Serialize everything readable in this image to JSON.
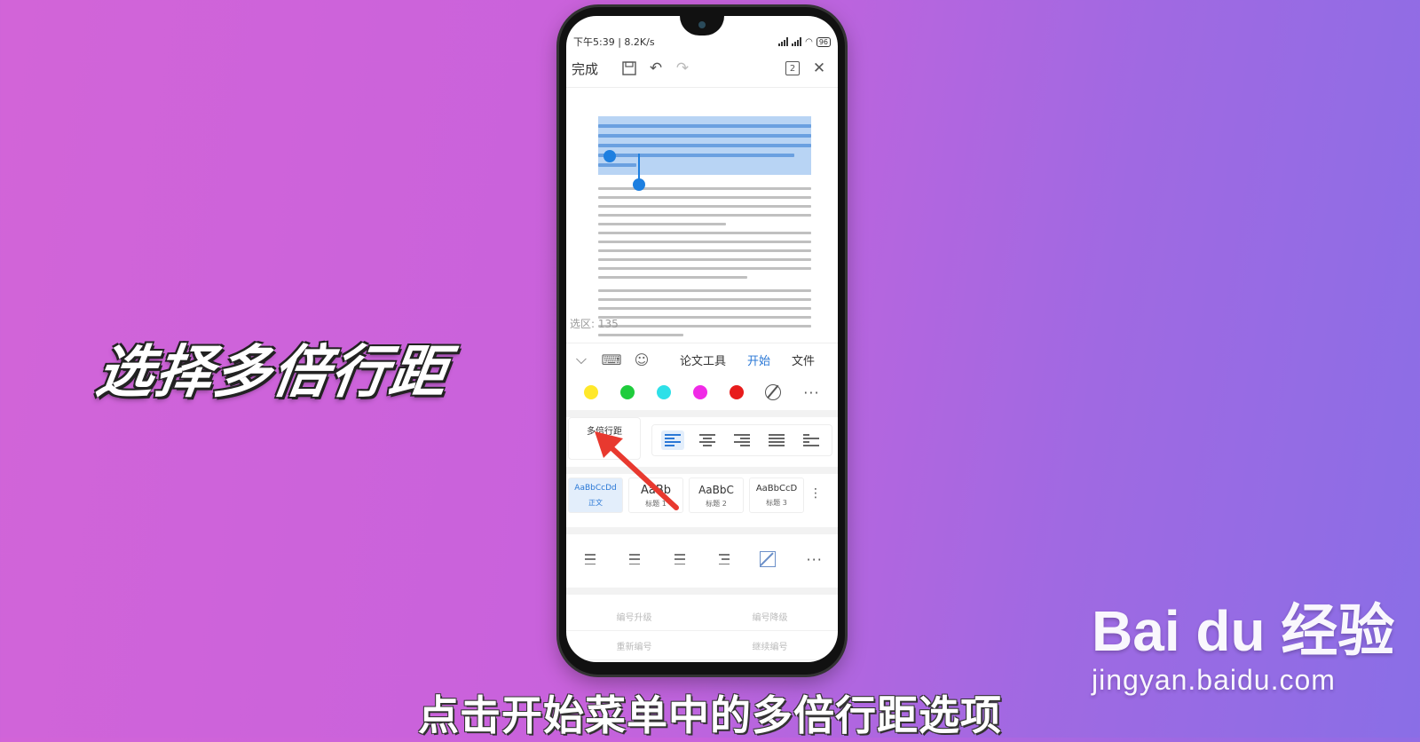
{
  "overlay": {
    "left_caption": "选择多倍行距",
    "subtitle": "点击开始菜单中的多倍行距选项",
    "watermark_brand": "Bai du 经验",
    "watermark_url": "jingyan.baidu.com"
  },
  "status_bar": {
    "left": "下午5:39 | 8.2K/s",
    "battery": "96"
  },
  "toolbar": {
    "done_label": "完成",
    "page_count": "2"
  },
  "document": {
    "selection_count": "选区: 135"
  },
  "tabs": [
    {
      "label": "论文工具"
    },
    {
      "label": "开始"
    },
    {
      "label": "文件"
    }
  ],
  "colors": [
    "#ffe82a",
    "#1fcc3c",
    "#2ee0e8",
    "#f02ae6",
    "#e81c1c"
  ],
  "line_spacing": {
    "label": "多倍行距"
  },
  "styles": [
    {
      "preview": "AaBbCcDd",
      "name": "正文"
    },
    {
      "preview": "AaBb",
      "name": "标题 1"
    },
    {
      "preview": "AaBbC",
      "name": "标题 2"
    },
    {
      "preview": "AaBbCcD",
      "name": "标题 3"
    }
  ],
  "numbering": {
    "promote": "编号升级",
    "demote": "编号降级",
    "restart": "重新编号",
    "continue": "继续编号"
  }
}
